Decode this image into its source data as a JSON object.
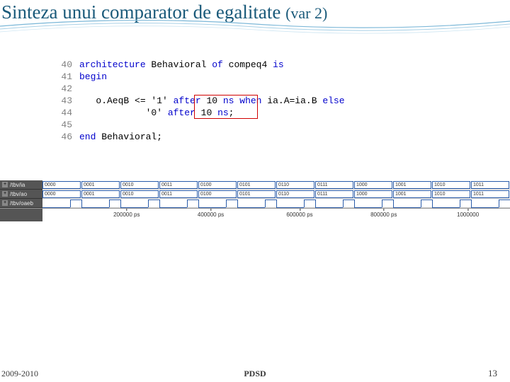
{
  "title_main": "Sinteza unui comparator de egalitate ",
  "title_var": "(var 2)",
  "code": {
    "lines": [
      {
        "num": "40",
        "tokens": [
          {
            "t": "architecture",
            "c": "kw-blue"
          },
          {
            "t": " Behavioral ",
            "c": "kw-black"
          },
          {
            "t": "of",
            "c": "kw-blue"
          },
          {
            "t": " compeq4 ",
            "c": "kw-black"
          },
          {
            "t": "is",
            "c": "kw-blue"
          }
        ]
      },
      {
        "num": "41",
        "tokens": [
          {
            "t": "begin",
            "c": "kw-blue"
          }
        ]
      },
      {
        "num": "42",
        "tokens": []
      },
      {
        "num": "43",
        "tokens": [
          {
            "t": "   o.AeqB <= '1' ",
            "c": "kw-black"
          },
          {
            "t": "after",
            "c": "kw-blue"
          },
          {
            "t": " 10 ",
            "c": "kw-black"
          },
          {
            "t": "ns",
            "c": "kw-blue"
          },
          {
            "t": " ",
            "c": "kw-black"
          },
          {
            "t": "when",
            "c": "kw-blue"
          },
          {
            "t": " ia.A=ia.B ",
            "c": "kw-black"
          },
          {
            "t": "else",
            "c": "kw-blue"
          }
        ]
      },
      {
        "num": "44",
        "tokens": [
          {
            "t": "            '0' ",
            "c": "kw-black"
          },
          {
            "t": "after",
            "c": "kw-blue"
          },
          {
            "t": " 10 ",
            "c": "kw-black"
          },
          {
            "t": "ns",
            "c": "kw-blue"
          },
          {
            "t": ";",
            "c": "kw-black"
          }
        ]
      },
      {
        "num": "45",
        "tokens": []
      },
      {
        "num": "46",
        "tokens": [
          {
            "t": "end",
            "c": "kw-blue"
          },
          {
            "t": " Behavioral;",
            "c": "kw-black"
          }
        ]
      }
    ]
  },
  "waveform": {
    "signals": [
      {
        "name": "/tbv/ia",
        "bus_values": [
          "0000",
          "0001",
          "0010",
          "0011",
          "0100",
          "0101",
          "0110",
          "0111",
          "1000",
          "1001",
          "1010",
          "1011"
        ]
      },
      {
        "name": "/tbv/ao",
        "bus_values": [
          "0000",
          "0001",
          "0010",
          "0011",
          "0100",
          "0101",
          "0110",
          "0111",
          "1000",
          "1001",
          "1010",
          "1011"
        ]
      },
      {
        "name": "/tbv/oaeb",
        "digital": true
      }
    ],
    "time_ticks": [
      "200000 ps",
      "400000 ps",
      "600000 ps",
      "800000 ps",
      "1000000"
    ],
    "time_positions_pct": [
      18,
      36,
      55,
      73,
      91
    ]
  },
  "footer": {
    "left": "2009-2010",
    "center": "PDSD",
    "page": "13"
  }
}
